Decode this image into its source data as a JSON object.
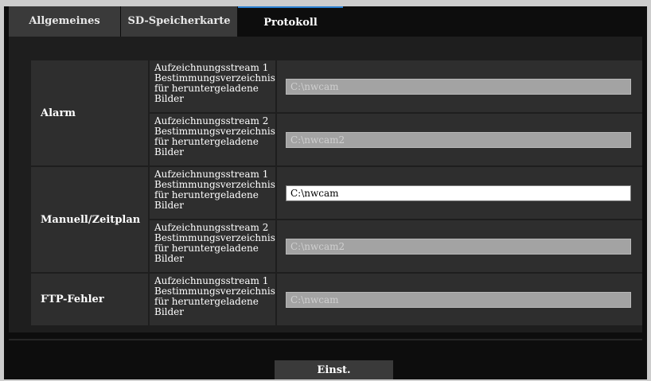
{
  "tabs": [
    {
      "label": "Allgemeines",
      "active": false
    },
    {
      "label": "SD-Speicherkarte",
      "active": false
    },
    {
      "label": "Protokoll",
      "active": true
    }
  ],
  "settings": {
    "groups": [
      {
        "name": "Alarm",
        "rows": [
          {
            "label": "Aufzeichnungsstream 1\nBestimmungsverzeichnis\nfür heruntergeladene\nBilder",
            "value": "C:\\nwcam",
            "enabled": false
          },
          {
            "label": "Aufzeichnungsstream 2\nBestimmungsverzeichnis\nfür heruntergeladene\nBilder",
            "value": "C:\\nwcam2",
            "enabled": false
          }
        ]
      },
      {
        "name": "Manuell/Zeitplan",
        "rows": [
          {
            "label": "Aufzeichnungsstream 1\nBestimmungsverzeichnis\nfür heruntergeladene\nBilder",
            "value": "C:\\nwcam",
            "enabled": true
          },
          {
            "label": "Aufzeichnungsstream 2\nBestimmungsverzeichnis\nfür heruntergeladene\nBilder",
            "value": "C:\\nwcam2",
            "enabled": false
          }
        ]
      },
      {
        "name": "FTP-Fehler",
        "rows": [
          {
            "label": "Aufzeichnungsstream 1\nBestimmungsverzeichnis\nfür heruntergeladene\nBilder",
            "value": "C:\\nwcam",
            "enabled": false
          }
        ]
      }
    ]
  },
  "footer": {
    "submit_label": "Einst."
  },
  "colors": {
    "accent": "#2a7fd0",
    "background": "#0d0d0d",
    "cell": "#2e2e2e",
    "disabled_field": "#a3a3a3"
  }
}
